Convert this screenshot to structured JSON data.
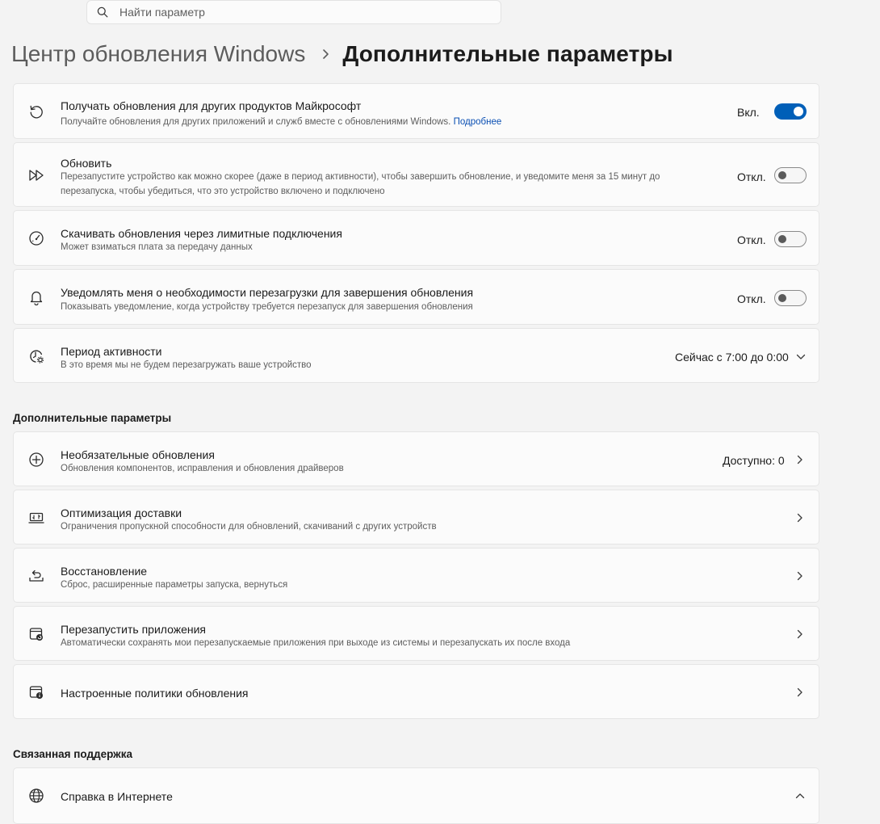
{
  "search": {
    "placeholder": "Найти параметр",
    "icon": "search-icon"
  },
  "breadcrumb": {
    "parent": "Центр обновления Windows",
    "current": "Дополнительные параметры"
  },
  "toggle_rows": [
    {
      "title": "Получать обновления для других продуктов Майкрософт",
      "desc": "Получайте обновления для других приложений и служб вместе с обновлениями Windows.",
      "link": "Подробнее",
      "state_label": "Вкл.",
      "on": true,
      "icon": "history-icon"
    },
    {
      "title": "Обновить",
      "desc": "Перезапустите устройство как можно скорее (даже в период активности), чтобы завершить обновление, и уведомите меня за 15 минут до перезапуска, чтобы убедиться, что это устройство включено и подключено",
      "state_label": "Откл.",
      "on": false,
      "icon": "fast-forward-icon"
    },
    {
      "title": "Скачивать обновления через лимитные подключения",
      "desc": "Может взиматься плата за передачу данных",
      "state_label": "Откл.",
      "on": false,
      "icon": "gauge-icon"
    },
    {
      "title": "Уведомлять меня о необходимости перезагрузки для завершения обновления",
      "desc": "Показывать уведомление, когда устройству требуется перезапуск для завершения обновления",
      "state_label": "Откл.",
      "on": false,
      "icon": "bell-icon"
    }
  ],
  "active_hours": {
    "title": "Период активности",
    "desc": "В это время мы не будем перезагружать ваше устройство",
    "value": "Сейчас с 7:00 до 0:00",
    "icon": "clock-gear-icon"
  },
  "additional_section": {
    "heading": "Дополнительные параметры",
    "items": [
      {
        "title": "Необязательные обновления",
        "desc": "Обновления компонентов, исправления и обновления драйверов",
        "value": "Доступно: 0",
        "icon": "plus-circle-icon"
      },
      {
        "title": "Оптимизация доставки",
        "desc": "Ограничения пропускной способности для обновлений, скачиваний с других устройств",
        "icon": "delivery-optimization-icon"
      },
      {
        "title": "Восстановление",
        "desc": "Сброс, расширенные параметры запуска, вернуться",
        "icon": "recovery-icon"
      },
      {
        "title": "Перезапустить приложения",
        "desc": "Автоматически сохранять мои перезапускаемые приложения при выходе из системы и перезапускать их после входа",
        "icon": "restart-apps-icon"
      },
      {
        "title": "Настроенные политики обновления",
        "icon": "policy-info-icon"
      }
    ]
  },
  "support_section": {
    "heading": "Связанная поддержка",
    "items": [
      {
        "title": "Справка в Интернете",
        "icon": "globe-icon"
      }
    ]
  },
  "colors": {
    "accent": "#005fb8",
    "link": "#0a4fb3",
    "background": "#f3f3f3",
    "card": "#fbfbfb"
  }
}
